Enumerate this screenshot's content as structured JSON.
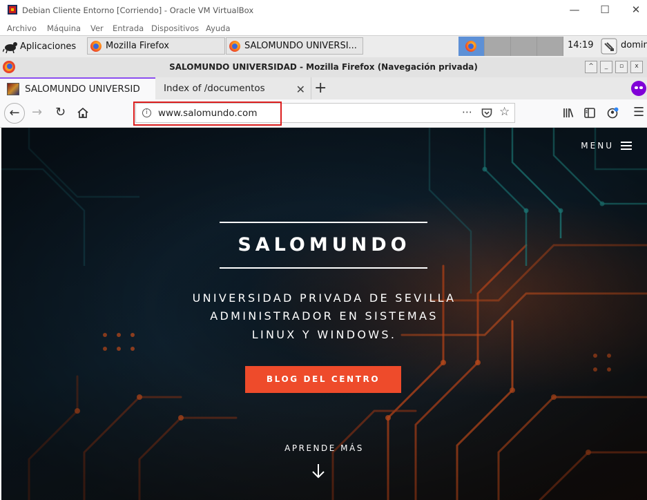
{
  "vbox": {
    "title": "Debian Cliente Entorno [Corriendo] - Oracle VM VirtualBox",
    "menu": [
      "Archivo",
      "Máquina",
      "Ver",
      "Entrada",
      "Dispositivos",
      "Ayuda"
    ],
    "controls": {
      "minimize": "—",
      "maximize": "☐",
      "close": "✕"
    }
  },
  "panel": {
    "apps_label": "Aplicaciones",
    "tasks": [
      {
        "label": "Mozilla Firefox"
      },
      {
        "label": "SALOMUNDO UNIVERSI..."
      }
    ],
    "clock": "14:19",
    "user": "domin"
  },
  "firefox": {
    "window_title": "SALOMUNDO UNIVERSIDAD - Mozilla Firefox (Navegación privada)",
    "tabs": [
      {
        "label": "SALOMUNDO UNIVERSIDA",
        "active": true
      },
      {
        "label": "Index of /documentos",
        "active": false
      }
    ],
    "new_tab": "+",
    "url": "www.salomundo.com",
    "icons": {
      "back": "back-arrow-icon",
      "forward": "forward-arrow-icon",
      "reload": "reload-icon",
      "home": "home-icon",
      "page_actions": "⋯",
      "pocket": "pocket-icon",
      "bookmark": "☆",
      "library": "library-icon",
      "sidebar": "sidebar-icon",
      "account": "account-icon",
      "menu": "☰"
    },
    "accent_color": "#8b4ef0",
    "highlight_color": "#dc1e1e"
  },
  "page": {
    "menu_label": "MENU",
    "brand": "SALOMUNDO",
    "tagline_lines": [
      "UNIVERSIDAD PRIVADA DE SEVILLA",
      "ADMINISTRADOR EN SISTEMAS",
      "LINUX Y WINDOWS."
    ],
    "cta_label": "BLOG DEL CENTRO",
    "cta_color": "#ee4b2b",
    "learn_more": "APRENDE MÁS"
  }
}
